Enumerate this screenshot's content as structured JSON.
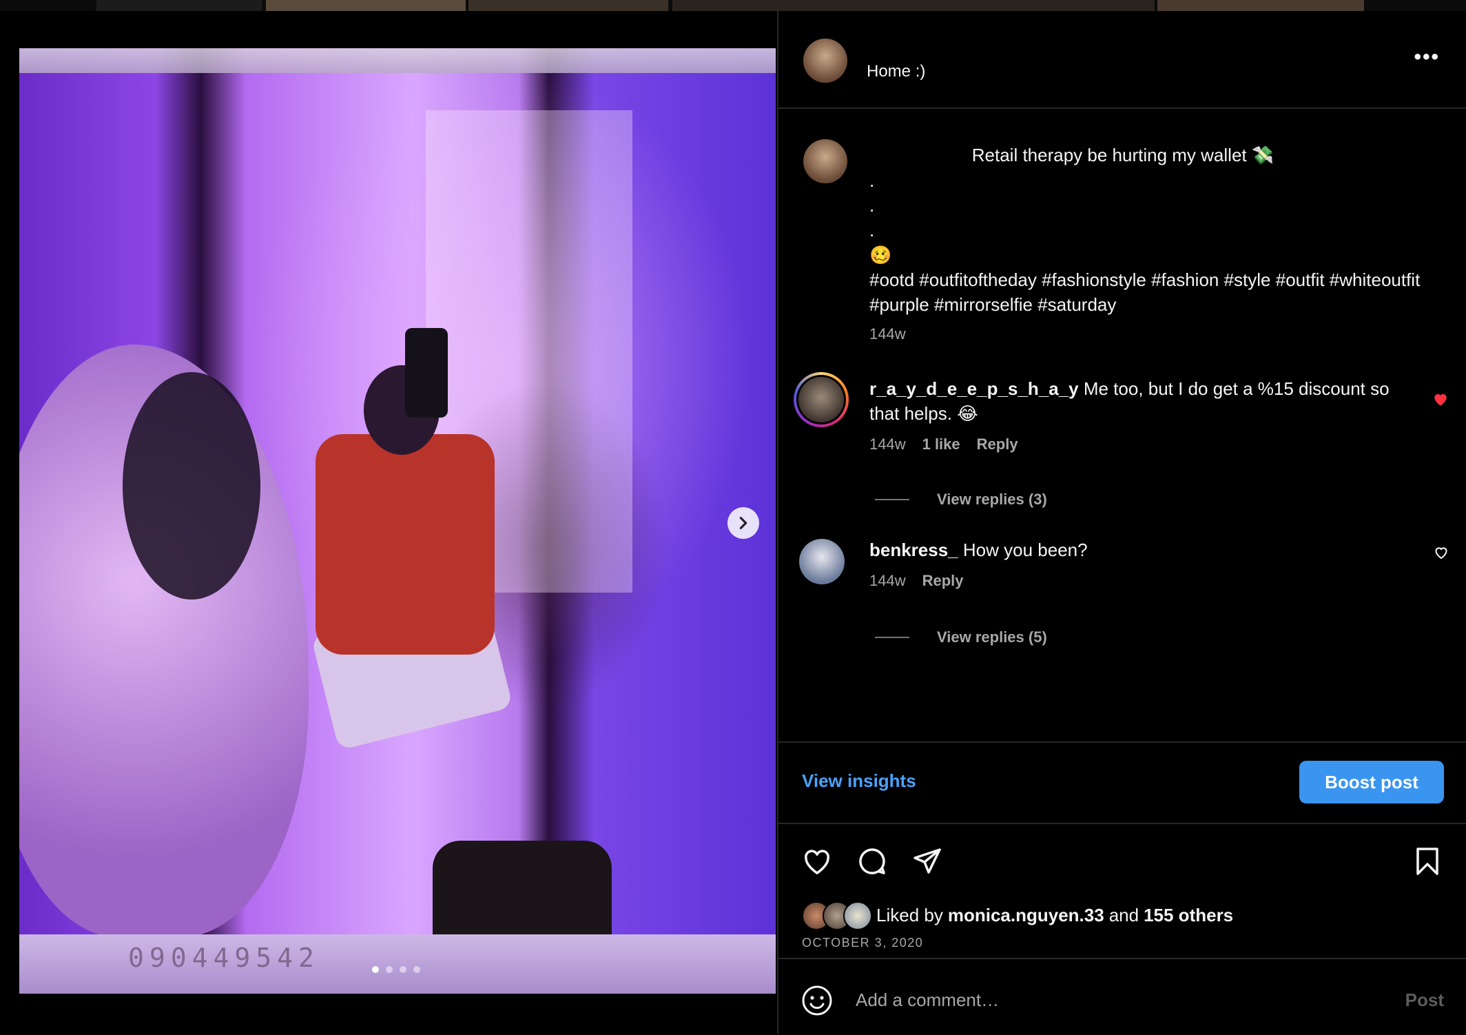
{
  "post": {
    "location": "Home :)",
    "caption_title": "Retail therapy be hurting my wallet 💸",
    "caption_dots": [
      ".",
      ".",
      "."
    ],
    "caption_emoji": "🥴",
    "caption_hashtags": "#ootd #outfitoftheday #fashionstyle #fashion #style #outfit #whiteoutfit #purple #mirrorselfie #saturday",
    "caption_time": "144w",
    "photo_serial": "090449542",
    "carousel": {
      "count": 4,
      "active": 0
    }
  },
  "comments": [
    {
      "username": "r_a_y_d_e_e_p_s_h_a_y",
      "text": "Me too, but I do get a %15 discount so that helps. 😂",
      "time": "144w",
      "likes": "1 like",
      "reply_label": "Reply",
      "liked": true,
      "view_replies": "View replies (3)"
    },
    {
      "username": "benkress_",
      "text": "How you been?",
      "time": "144w",
      "reply_label": "Reply",
      "liked": false,
      "view_replies": "View replies (5)"
    }
  ],
  "insights": {
    "link": "View insights",
    "boost": "Boost post"
  },
  "engagement": {
    "liked_prefix": "Liked by",
    "liked_user": "monica.nguyen.33",
    "liked_and": "and",
    "liked_others": "155 others",
    "date": "OCTOBER 3, 2020"
  },
  "comment_input": {
    "placeholder": "Add a comment…",
    "post_label": "Post"
  },
  "colors": {
    "accent": "#3a95f0",
    "link": "#4aa3ff",
    "like_red": "#ff3040",
    "muted": "#a8a8a8"
  },
  "icons": [
    "more-icon",
    "chevron-right-icon",
    "heart-icon",
    "comment-icon",
    "share-icon",
    "bookmark-icon",
    "emoji-icon"
  ]
}
